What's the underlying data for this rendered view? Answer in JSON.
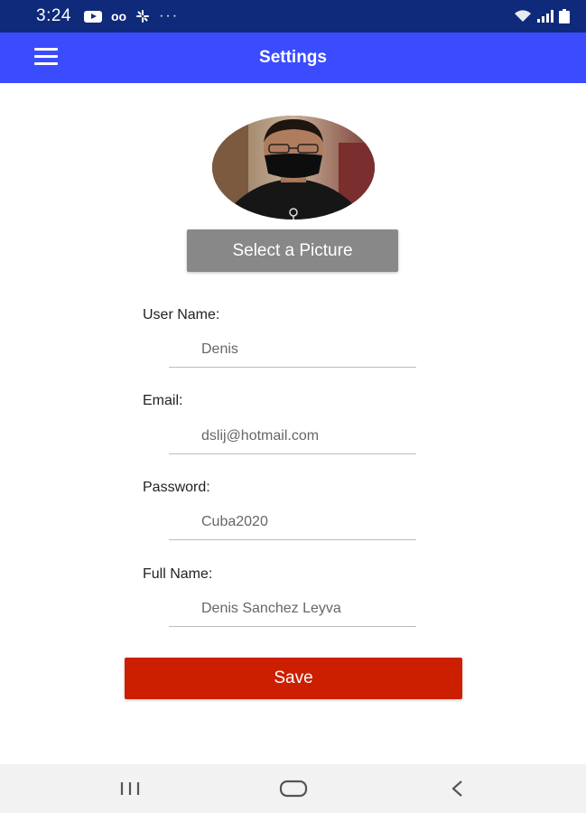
{
  "status_bar": {
    "time": "3:24",
    "icons": [
      "youtube-icon",
      "voicemail-icon",
      "pinwheel-icon",
      "more-dots-icon",
      "wifi-icon",
      "signal-icon",
      "battery-icon"
    ]
  },
  "app_bar": {
    "title": "Settings",
    "menu_icon": "hamburger-menu-icon",
    "color": "#3b4cff"
  },
  "profile": {
    "avatar_icon": "profile-photo",
    "select_picture_label": "Select a Picture"
  },
  "form": {
    "user_name": {
      "label": "User Name:",
      "value": "Denis"
    },
    "email": {
      "label": "Email:",
      "value": "dslij@hotmail.com"
    },
    "password": {
      "label": "Password:",
      "value": "Cuba2020"
    },
    "full_name": {
      "label": "Full Name:",
      "value": "Denis Sanchez Leyva"
    }
  },
  "save_button": {
    "label": "Save",
    "color": "#cc1f00"
  },
  "nav_bar": {
    "icons": [
      "recent-apps-icon",
      "home-icon",
      "back-icon"
    ]
  }
}
